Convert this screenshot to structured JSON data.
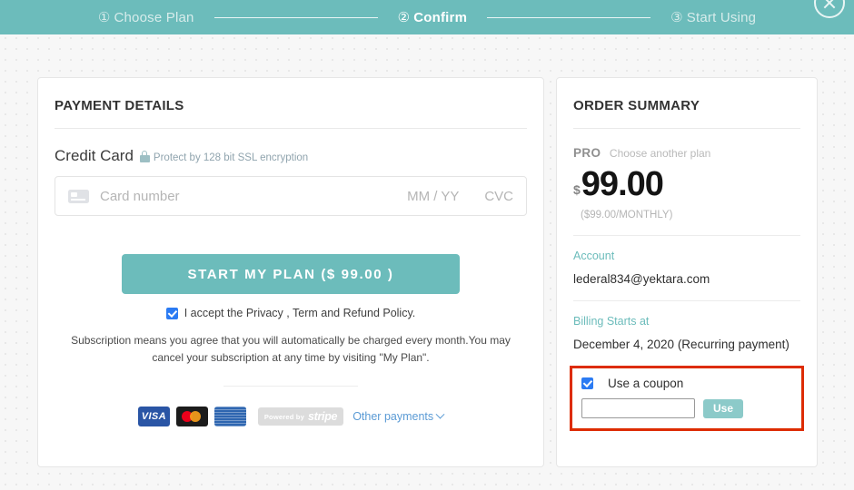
{
  "stepbar": {
    "steps": [
      {
        "num": "①",
        "label": "Choose Plan",
        "active": false
      },
      {
        "num": "②",
        "label": "Confirm",
        "active": true
      },
      {
        "num": "③",
        "label": "Start Using",
        "active": false
      }
    ],
    "close_icon": "close-circle-icon"
  },
  "payment": {
    "title": "PAYMENT DETAILS",
    "credit_card_label": "Credit Card",
    "lock_icon": "lock-icon",
    "ssl_text": "Protect by 128 bit SSL encryption",
    "card_icon": "credit-card-icon",
    "card_number_placeholder": "Card number",
    "expiry_placeholder": "MM / YY",
    "cvc_placeholder": "CVC",
    "cta_label": "START MY PLAN ($ 99.00 )",
    "accept_text": "I accept the Privacy , Term and Refund Policy.",
    "accept_checked": true,
    "subscription_note": "Subscription means you agree that you will automatically be charged every month.You may cancel your subscription at any time by visiting \"My Plan\".",
    "logos": {
      "visa": "VISA",
      "mastercard": "mastercard-icon",
      "amex": "AMERICAN EXPRESS",
      "stripe_powered_by": "Powered by",
      "stripe_word": "stripe",
      "other_payments": "Other payments",
      "chevron_icon": "chevron-down-icon"
    }
  },
  "summary": {
    "title": "ORDER SUMMARY",
    "plan_name": "PRO",
    "change_plan_link": "Choose another plan",
    "currency": "$",
    "price": "99.00",
    "price_period": "($99.00/MONTHLY)",
    "account_label": "Account",
    "account_email": "lederal834@yektara.com",
    "billing_label": "Billing Starts at",
    "billing_date": "December 4, 2020 (Recurring payment)",
    "coupon": {
      "checkbox_label": "Use a coupon",
      "checked": true,
      "input_value": "",
      "use_button": "Use",
      "highlight_color": "#dd2c00"
    }
  },
  "colors": {
    "accent_teal": "#6cbcbb",
    "link_blue": "#5b9bd5",
    "checkbox_blue": "#2b7bf3",
    "highlight_red": "#dd2c00"
  }
}
